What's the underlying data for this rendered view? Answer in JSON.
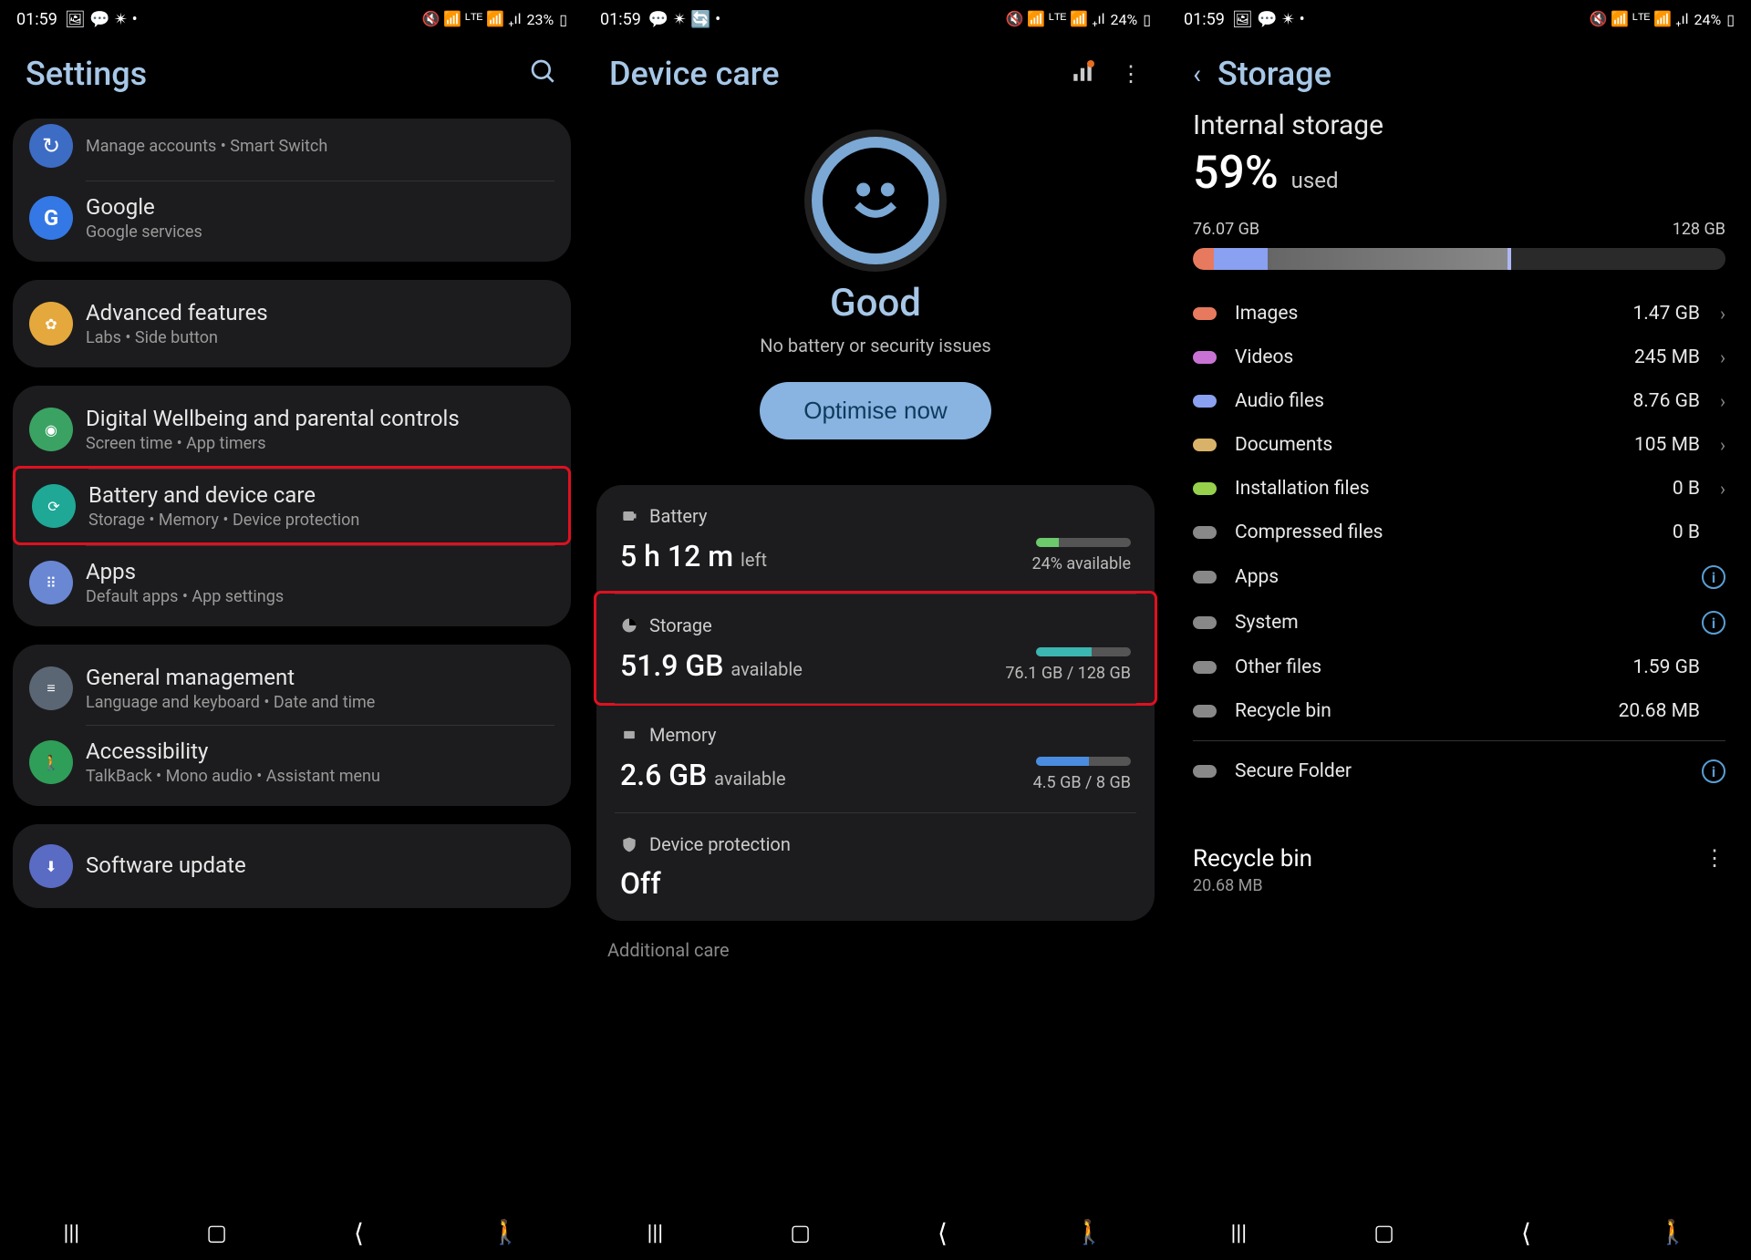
{
  "screen1": {
    "time": "01:59",
    "battery": "23%",
    "title": "Settings",
    "backup_sub": "Manage accounts  •  Smart Switch",
    "google": {
      "title": "Google",
      "sub": "Google services"
    },
    "advanced": {
      "title": "Advanced features",
      "sub": "Labs  •  Side button"
    },
    "wellbeing": {
      "title": "Digital Wellbeing and parental controls",
      "sub": "Screen time  •  App timers"
    },
    "devicecare": {
      "title": "Battery and device care",
      "sub": "Storage  •  Memory  •  Device protection"
    },
    "apps": {
      "title": "Apps",
      "sub": "Default apps  •  App settings"
    },
    "general": {
      "title": "General management",
      "sub": "Language and keyboard  •  Date and time"
    },
    "accessibility": {
      "title": "Accessibility",
      "sub": "TalkBack  •  Mono audio  •  Assistant menu"
    },
    "software": {
      "title": "Software update"
    }
  },
  "screen2": {
    "time": "01:59",
    "battery": "24%",
    "title": "Device care",
    "status": "Good",
    "status_sub": "No battery or security issues",
    "optimise": "Optimise now",
    "battery_row": {
      "label": "Battery",
      "value": "5 h 12 m",
      "unit": "left",
      "right": "24% available"
    },
    "storage_row": {
      "label": "Storage",
      "value": "51.9 GB",
      "unit": "available",
      "right": "76.1 GB / 128 GB"
    },
    "memory_row": {
      "label": "Memory",
      "value": "2.6 GB",
      "unit": "available",
      "right": "4.5 GB / 8 GB"
    },
    "protection_row": {
      "label": "Device protection",
      "value": "Off"
    },
    "additional": "Additional care"
  },
  "screen3": {
    "time": "01:59",
    "battery": "24%",
    "title": "Storage",
    "heading": "Internal storage",
    "pct": "59%",
    "used": "used",
    "used_gb": "76.07 GB",
    "total_gb": "128 GB",
    "cats": [
      {
        "name": "Images",
        "val": "1.47 GB",
        "color": "#e77a5e",
        "chev": true
      },
      {
        "name": "Videos",
        "val": "245 MB",
        "color": "#c873d4",
        "chev": true
      },
      {
        "name": "Audio files",
        "val": "8.76 GB",
        "color": "#8aa0f0",
        "chev": true
      },
      {
        "name": "Documents",
        "val": "105 MB",
        "color": "#d9b26a",
        "chev": true
      },
      {
        "name": "Installation files",
        "val": "0 B",
        "color": "#97d14c",
        "chev": true
      },
      {
        "name": "Compressed files",
        "val": "0 B",
        "color": "#888",
        "chev": false
      },
      {
        "name": "Apps",
        "val": "",
        "color": "#888",
        "chev": false,
        "info": true
      },
      {
        "name": "System",
        "val": "",
        "color": "#888",
        "chev": false,
        "info": true
      },
      {
        "name": "Other files",
        "val": "1.59 GB",
        "color": "#888",
        "chev": false
      },
      {
        "name": "Recycle bin",
        "val": "20.68 MB",
        "color": "#888",
        "chev": false
      }
    ],
    "secure": {
      "name": "Secure Folder"
    },
    "recycle": {
      "title": "Recycle bin",
      "sub": "20.68 MB"
    }
  }
}
